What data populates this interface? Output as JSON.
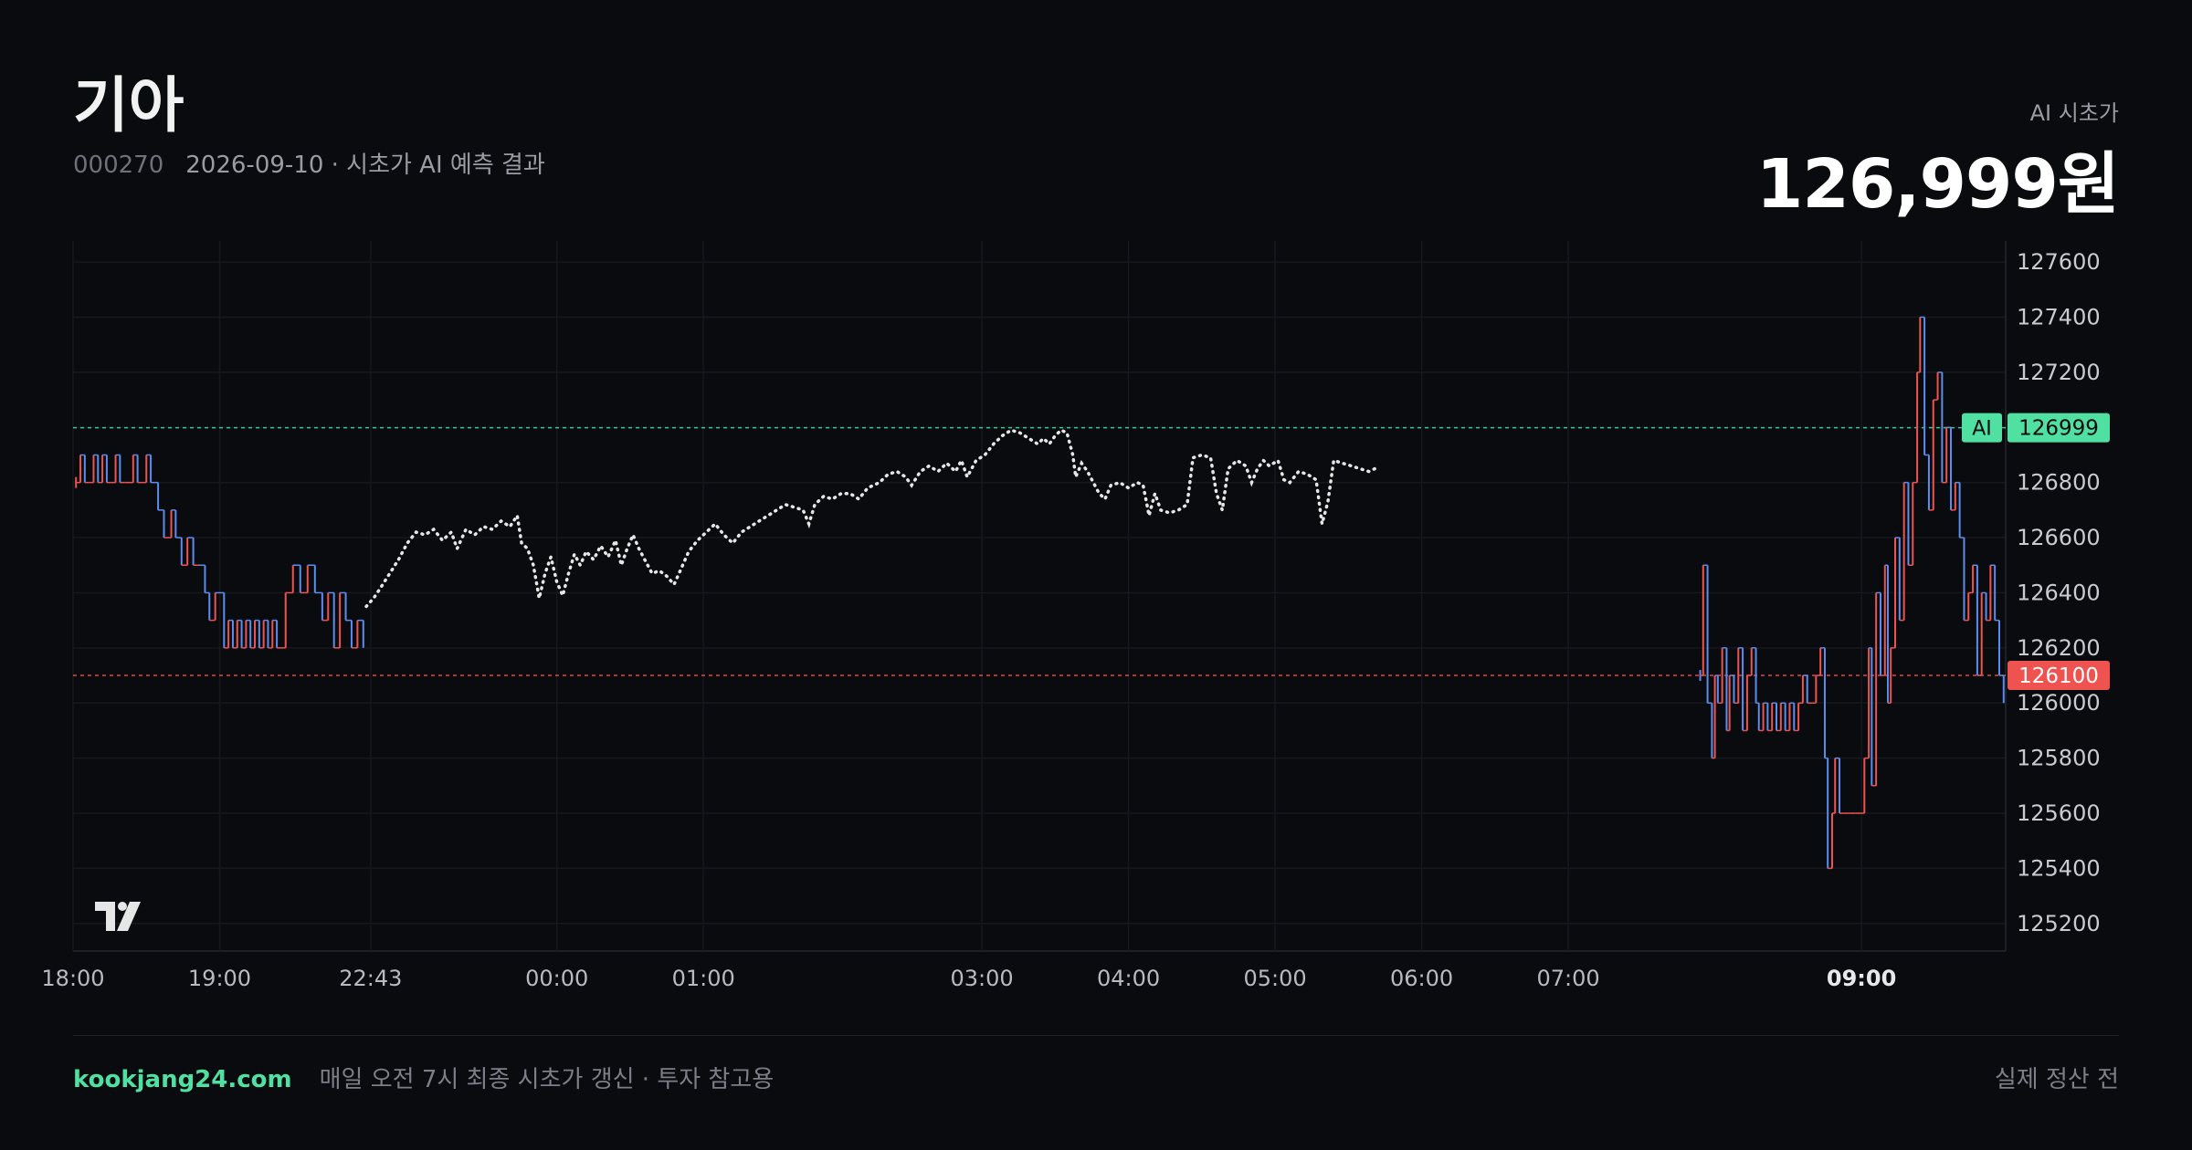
{
  "header": {
    "title": "기아",
    "code": "000270",
    "subtitle": "2026-09-10 · 시초가 AI 예측 결과",
    "ai_label": "AI 시초가",
    "ai_price": "126,999원"
  },
  "footer": {
    "brand": "kookjang24.com",
    "note": "매일 오전 7시 최종 시초가 갱신 · 투자 참고용",
    "status": "실제 정산 전"
  },
  "colors": {
    "background": "#0a0b0e",
    "up": "#ef5350",
    "down": "#5b8def",
    "ai_line": "#4fe0a2",
    "close_line": "#ef5350",
    "prediction": "#e6e6e6"
  },
  "chart_data": {
    "type": "line",
    "y_ticks": [
      127600,
      127400,
      127200,
      127000,
      126800,
      126600,
      126400,
      126200,
      126000,
      125800,
      125600,
      125400,
      125200
    ],
    "y_tick_labels": [
      "127600",
      "127400",
      "127200",
      "",
      "126800",
      "126600",
      "126400",
      "126200",
      "126000",
      "125800",
      "125600",
      "125400",
      "125200"
    ],
    "ylim": [
      125100,
      127650
    ],
    "x_ticks": [
      {
        "label": "18:00",
        "t": 0,
        "bold": false
      },
      {
        "label": "19:00",
        "t": 1,
        "bold": false
      },
      {
        "label": "22:43",
        "t": 2.03,
        "bold": false
      },
      {
        "label": "00:00",
        "t": 3.3,
        "bold": false
      },
      {
        "label": "01:00",
        "t": 4.3,
        "bold": false
      },
      {
        "label": "03:00",
        "t": 6.2,
        "bold": false
      },
      {
        "label": "04:00",
        "t": 7.2,
        "bold": false
      },
      {
        "label": "05:00",
        "t": 8.2,
        "bold": false
      },
      {
        "label": "06:00",
        "t": 9.2,
        "bold": false
      },
      {
        "label": "07:00",
        "t": 10.2,
        "bold": false
      },
      {
        "label": "09:00",
        "t": 12.2,
        "bold": true
      }
    ],
    "xlim": [
      0,
      13.2
    ],
    "ai_line": {
      "label": "AI",
      "value": 126999
    },
    "close_line": {
      "value": 126100
    },
    "grid": true,
    "series": [
      {
        "style": "ticks",
        "points": [
          [
            0.02,
            126800
          ],
          [
            0.05,
            126900
          ],
          [
            0.08,
            126800
          ],
          [
            0.11,
            126800
          ],
          [
            0.14,
            126900
          ],
          [
            0.17,
            126800
          ],
          [
            0.2,
            126900
          ],
          [
            0.23,
            126800
          ],
          [
            0.26,
            126800
          ],
          [
            0.29,
            126900
          ],
          [
            0.32,
            126800
          ],
          [
            0.35,
            126800
          ],
          [
            0.38,
            126800
          ],
          [
            0.41,
            126900
          ],
          [
            0.44,
            126800
          ],
          [
            0.47,
            126800
          ],
          [
            0.5,
            126900
          ],
          [
            0.53,
            126800
          ],
          [
            0.58,
            126700
          ],
          [
            0.62,
            126600
          ],
          [
            0.67,
            126700
          ],
          [
            0.7,
            126600
          ],
          [
            0.74,
            126500
          ],
          [
            0.78,
            126600
          ],
          [
            0.82,
            126500
          ],
          [
            0.86,
            126500
          ],
          [
            0.9,
            126400
          ],
          [
            0.93,
            126300
          ],
          [
            0.97,
            126400
          ],
          [
            1.03,
            126200
          ],
          [
            1.06,
            126300
          ],
          [
            1.09,
            126200
          ],
          [
            1.12,
            126300
          ],
          [
            1.15,
            126200
          ],
          [
            1.18,
            126300
          ],
          [
            1.21,
            126200
          ],
          [
            1.24,
            126300
          ],
          [
            1.27,
            126200
          ],
          [
            1.3,
            126300
          ],
          [
            1.33,
            126200
          ],
          [
            1.36,
            126300
          ],
          [
            1.39,
            126200
          ],
          [
            1.45,
            126400
          ],
          [
            1.5,
            126500
          ],
          [
            1.55,
            126400
          ],
          [
            1.6,
            126500
          ],
          [
            1.65,
            126400
          ],
          [
            1.7,
            126300
          ],
          [
            1.74,
            126400
          ],
          [
            1.78,
            126200
          ],
          [
            1.82,
            126400
          ],
          [
            1.86,
            126300
          ],
          [
            1.9,
            126200
          ],
          [
            1.94,
            126300
          ],
          [
            1.98,
            126200
          ],
          [
            11.1,
            126100
          ],
          [
            11.12,
            126500
          ],
          [
            11.15,
            126000
          ],
          [
            11.18,
            125800
          ],
          [
            11.2,
            126100
          ],
          [
            11.22,
            126000
          ],
          [
            11.25,
            126200
          ],
          [
            11.28,
            125900
          ],
          [
            11.3,
            126100
          ],
          [
            11.33,
            126000
          ],
          [
            11.36,
            126200
          ],
          [
            11.39,
            125900
          ],
          [
            11.42,
            126100
          ],
          [
            11.45,
            126200
          ],
          [
            11.48,
            126000
          ],
          [
            11.5,
            125900
          ],
          [
            11.53,
            126000
          ],
          [
            11.56,
            125900
          ],
          [
            11.59,
            126000
          ],
          [
            11.62,
            125900
          ],
          [
            11.65,
            126000
          ],
          [
            11.68,
            125900
          ],
          [
            11.71,
            126000
          ],
          [
            11.74,
            125900
          ],
          [
            11.77,
            126000
          ],
          [
            11.8,
            126100
          ],
          [
            11.83,
            126000
          ],
          [
            11.86,
            126000
          ],
          [
            11.89,
            126100
          ],
          [
            11.92,
            126200
          ],
          [
            11.95,
            125800
          ],
          [
            11.97,
            125400
          ],
          [
            12.0,
            125600
          ],
          [
            12.02,
            125800
          ],
          [
            12.05,
            125600
          ],
          [
            12.08,
            125600
          ],
          [
            12.12,
            125600
          ],
          [
            12.16,
            125600
          ],
          [
            12.19,
            125600
          ],
          [
            12.22,
            125800
          ],
          [
            12.25,
            126200
          ],
          [
            12.27,
            125700
          ],
          [
            12.3,
            126400
          ],
          [
            12.33,
            126100
          ],
          [
            12.36,
            126500
          ],
          [
            12.38,
            126000
          ],
          [
            12.4,
            126200
          ],
          [
            12.43,
            126600
          ],
          [
            12.46,
            126300
          ],
          [
            12.49,
            126800
          ],
          [
            12.52,
            126500
          ],
          [
            12.55,
            126800
          ],
          [
            12.58,
            127200
          ],
          [
            12.6,
            127400
          ],
          [
            12.63,
            126900
          ],
          [
            12.66,
            126700
          ],
          [
            12.69,
            127100
          ],
          [
            12.72,
            127200
          ],
          [
            12.75,
            126800
          ],
          [
            12.78,
            127000
          ],
          [
            12.81,
            126700
          ],
          [
            12.84,
            126800
          ],
          [
            12.87,
            126600
          ],
          [
            12.9,
            126300
          ],
          [
            12.93,
            126400
          ],
          [
            12.96,
            126500
          ],
          [
            12.99,
            126100
          ],
          [
            13.02,
            126400
          ],
          [
            13.05,
            126300
          ],
          [
            13.08,
            126500
          ],
          [
            13.11,
            126300
          ],
          [
            13.14,
            126100
          ],
          [
            13.17,
            126000
          ]
        ]
      },
      {
        "style": "dotted",
        "points": [
          [
            2.0,
            126350
          ],
          [
            2.05,
            126380
          ],
          [
            2.1,
            126420
          ],
          [
            2.16,
            126470
          ],
          [
            2.22,
            126520
          ],
          [
            2.28,
            126580
          ],
          [
            2.34,
            126620
          ],
          [
            2.4,
            126610
          ],
          [
            2.46,
            126630
          ],
          [
            2.52,
            126590
          ],
          [
            2.58,
            126620
          ],
          [
            2.62,
            126560
          ],
          [
            2.68,
            126630
          ],
          [
            2.74,
            126610
          ],
          [
            2.8,
            126640
          ],
          [
            2.86,
            126630
          ],
          [
            2.92,
            126660
          ],
          [
            2.98,
            126640
          ],
          [
            3.03,
            126680
          ],
          [
            3.06,
            126580
          ],
          [
            3.1,
            126560
          ],
          [
            3.14,
            126500
          ],
          [
            3.18,
            126380
          ],
          [
            3.22,
            126470
          ],
          [
            3.26,
            126530
          ],
          [
            3.3,
            126440
          ],
          [
            3.34,
            126390
          ],
          [
            3.38,
            126470
          ],
          [
            3.42,
            126540
          ],
          [
            3.46,
            126500
          ],
          [
            3.5,
            126550
          ],
          [
            3.55,
            126520
          ],
          [
            3.6,
            126570
          ],
          [
            3.65,
            126530
          ],
          [
            3.7,
            126590
          ],
          [
            3.74,
            126500
          ],
          [
            3.78,
            126560
          ],
          [
            3.82,
            126610
          ],
          [
            3.86,
            126560
          ],
          [
            3.9,
            126520
          ],
          [
            3.95,
            126470
          ],
          [
            4.0,
            126480
          ],
          [
            4.05,
            126460
          ],
          [
            4.1,
            126430
          ],
          [
            4.15,
            126490
          ],
          [
            4.2,
            126550
          ],
          [
            4.26,
            126590
          ],
          [
            4.32,
            126620
          ],
          [
            4.38,
            126650
          ],
          [
            4.44,
            126610
          ],
          [
            4.5,
            126580
          ],
          [
            4.56,
            126620
          ],
          [
            4.62,
            126640
          ],
          [
            4.68,
            126660
          ],
          [
            4.74,
            126680
          ],
          [
            4.8,
            126700
          ],
          [
            4.86,
            126720
          ],
          [
            4.92,
            126710
          ],
          [
            4.98,
            126700
          ],
          [
            5.02,
            126650
          ],
          [
            5.06,
            126720
          ],
          [
            5.12,
            126750
          ],
          [
            5.18,
            126740
          ],
          [
            5.24,
            126760
          ],
          [
            5.3,
            126760
          ],
          [
            5.36,
            126740
          ],
          [
            5.42,
            126780
          ],
          [
            5.5,
            126800
          ],
          [
            5.56,
            126830
          ],
          [
            5.62,
            126840
          ],
          [
            5.68,
            126820
          ],
          [
            5.72,
            126790
          ],
          [
            5.78,
            126840
          ],
          [
            5.84,
            126860
          ],
          [
            5.9,
            126840
          ],
          [
            5.96,
            126870
          ],
          [
            6.02,
            126840
          ],
          [
            6.06,
            126880
          ],
          [
            6.1,
            126820
          ],
          [
            6.16,
            126880
          ],
          [
            6.22,
            126900
          ],
          [
            6.28,
            126940
          ],
          [
            6.34,
            126970
          ],
          [
            6.4,
            126990
          ],
          [
            6.46,
            126980
          ],
          [
            6.52,
            126960
          ],
          [
            6.58,
            126940
          ],
          [
            6.62,
            126960
          ],
          [
            6.66,
            126940
          ],
          [
            6.7,
            126970
          ],
          [
            6.74,
            126990
          ],
          [
            6.78,
            126980
          ],
          [
            6.82,
            126900
          ],
          [
            6.84,
            126820
          ],
          [
            6.88,
            126870
          ],
          [
            6.92,
            126840
          ],
          [
            6.96,
            126800
          ],
          [
            7.0,
            126760
          ],
          [
            7.04,
            126740
          ],
          [
            7.08,
            126790
          ],
          [
            7.14,
            126800
          ],
          [
            7.2,
            126780
          ],
          [
            7.26,
            126800
          ],
          [
            7.3,
            126790
          ],
          [
            7.34,
            126680
          ],
          [
            7.38,
            126760
          ],
          [
            7.42,
            126700
          ],
          [
            7.48,
            126690
          ],
          [
            7.54,
            126700
          ],
          [
            7.6,
            126720
          ],
          [
            7.64,
            126890
          ],
          [
            7.7,
            126900
          ],
          [
            7.76,
            126890
          ],
          [
            7.8,
            126760
          ],
          [
            7.84,
            126700
          ],
          [
            7.88,
            126850
          ],
          [
            7.94,
            126880
          ],
          [
            8.0,
            126860
          ],
          [
            8.04,
            126800
          ],
          [
            8.08,
            126850
          ],
          [
            8.12,
            126880
          ],
          [
            8.16,
            126860
          ],
          [
            8.22,
            126880
          ],
          [
            8.26,
            126810
          ],
          [
            8.3,
            126800
          ],
          [
            8.36,
            126840
          ],
          [
            8.42,
            126830
          ],
          [
            8.48,
            126810
          ],
          [
            8.52,
            126650
          ],
          [
            8.56,
            126730
          ],
          [
            8.6,
            126880
          ],
          [
            8.66,
            126870
          ],
          [
            8.72,
            126860
          ],
          [
            8.78,
            126850
          ],
          [
            8.84,
            126840
          ],
          [
            8.88,
            126850
          ]
        ]
      }
    ]
  }
}
